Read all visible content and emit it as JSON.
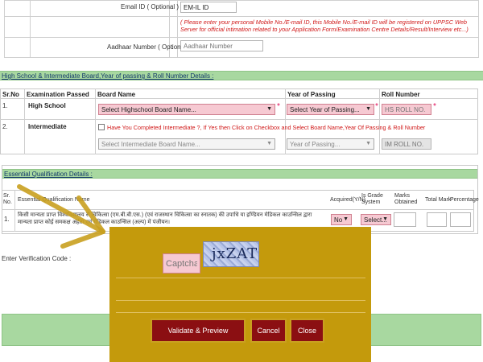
{
  "contact": {
    "email_label": "Email ID ( Optional )",
    "email_value": "EM-IL ID",
    "colon": ":",
    "mobile_note": "( Please enter your personal Mobile No./E-mail ID, this Mobile No./E-mail ID will be registered on UPPSC Web Server for official intimation related to your Application Form/Examination Centre Details/Result/Interview etc...)",
    "aadhaar_label": "Aadhaar Number ( Optional )",
    "aadhaar_placeholder": "Aadhaar Number"
  },
  "board_section": {
    "title": "High School & Intermediate Board,Year of passing & Roll Number Details :",
    "headers": [
      "Sr.No",
      "Examination Passed",
      "Board Name",
      "Year of Passing",
      "Roll Number"
    ],
    "rows": [
      {
        "sr": "1.",
        "exam": "High School",
        "board": "Select Highschool Board Name...",
        "year": "Select Year of Passing...",
        "roll_placeholder": "HS ROLL NO."
      },
      {
        "sr": "2.",
        "exam": "Intermediate",
        "checkbox_text": "Have You Completed Intermediate ?, If Yes then Click on Checkbox and Select Board Name,Year Of Passing & Roll Number",
        "board": "Select Intermediate Board Name...",
        "year": "Year of Passing...",
        "roll_placeholder": "IM ROLL NO."
      }
    ]
  },
  "essential_section": {
    "title": "Essential Qualification Details :",
    "headers": {
      "sr": "Sr. No.",
      "name": "Essential Qualification Name",
      "acquired": "Acquired(Y/N)",
      "grade": "Is Grade System",
      "marks": "Marks Obtained",
      "total": "Total Mark",
      "pct": "Percentage"
    },
    "row": {
      "sr": "1.",
      "name": "किसी मान्यता प्राप्त विश्वविद्यालय से चिकित्सा (एम.बी.बी.एस.) (एवं राजस्थान चिकित्सा का स्नातक) की उपाधि या इण्डियन मेडिकल काउन्सिल द्वारा मान्यता प्राप्त कोई समकक्ष अर्हता एवं मेडिकल काउन्सिल (अल्प) में पंजीयन।",
      "acquired": "No",
      "grade": "Select..."
    }
  },
  "verification": {
    "label": "Enter Verification Code :",
    "captcha_placeholder": "Captcha",
    "captcha_text": "jxZAT"
  },
  "buttons": {
    "validate": "Validate & Preview",
    "cancel": "Cancel",
    "close": "Close"
  },
  "colors": {
    "section_header": "#a8d8a0",
    "overlay": "#c49a0c",
    "button": "#8b0f12",
    "arrow": "#c9a020"
  }
}
